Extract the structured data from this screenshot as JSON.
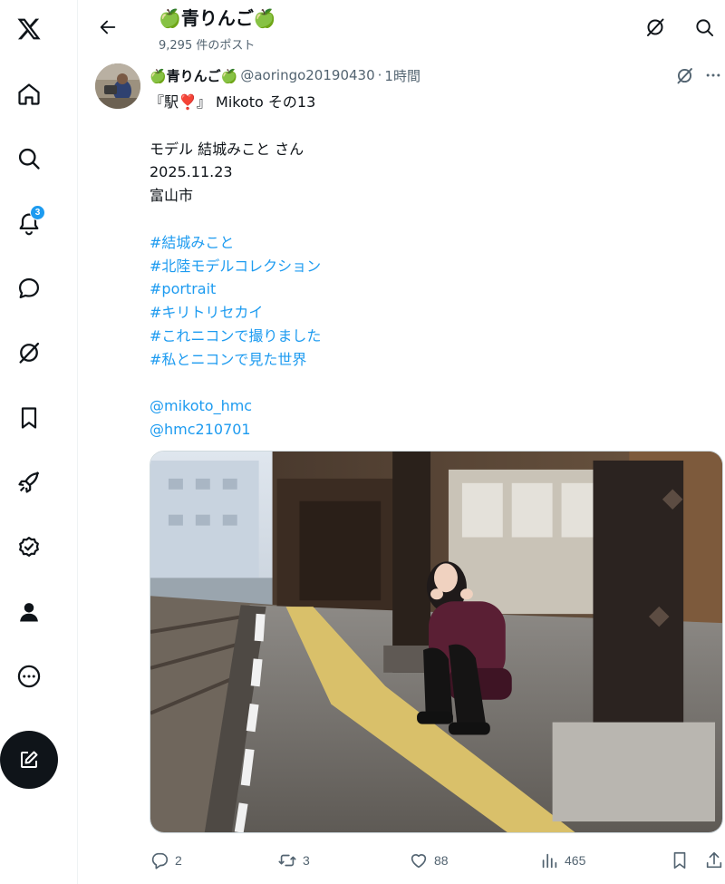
{
  "nav": {
    "items": [
      {
        "name": "x-logo",
        "icon": "x-logo-icon"
      },
      {
        "name": "home",
        "icon": "home-icon"
      },
      {
        "name": "explore",
        "icon": "search-icon"
      },
      {
        "name": "notifications",
        "icon": "bell-icon",
        "badge": "3"
      },
      {
        "name": "messages",
        "icon": "chat-bubble-icon"
      },
      {
        "name": "grok",
        "icon": "grok-icon"
      },
      {
        "name": "bookmarks",
        "icon": "bookmark-icon"
      },
      {
        "name": "jobs",
        "icon": "rocket-icon"
      },
      {
        "name": "verified",
        "icon": "verified-badge-icon"
      },
      {
        "name": "profile",
        "icon": "person-icon"
      },
      {
        "name": "more",
        "icon": "more-circle-icon"
      }
    ],
    "compose_icon": "compose-icon"
  },
  "header": {
    "title": "🍏青りんご🍏",
    "post_count": "9,295 件のポスト"
  },
  "tweet": {
    "display_name": "🍏青りんご🍏",
    "handle": "@aoringo20190430",
    "separator": "·",
    "time": "1時間",
    "lines": {
      "l1": "『駅❣️』 Mikoto その13",
      "l2": "モデル 結城みこと さん",
      "l3": "2025.11.23",
      "l4": "富山市",
      "h1": "#結城みこと",
      "h2": "#北陸モデルコレクション",
      "h3": "#portrait",
      "h4": "#キリトリセカイ",
      "h5": "#これニコンで撮りました",
      "h6": "#私とニコンで見た世界",
      "m1": "@mikoto_hmc",
      "m2": "@hmc210701"
    },
    "image_alt": "station-platform-portrait-photo"
  },
  "actions": {
    "replies": "2",
    "reposts": "3",
    "likes": "88",
    "views": "465"
  },
  "colors": {
    "link": "#1d9bf0",
    "text": "#0f1419",
    "muted": "#536471",
    "badge": "#1d9bf0"
  }
}
